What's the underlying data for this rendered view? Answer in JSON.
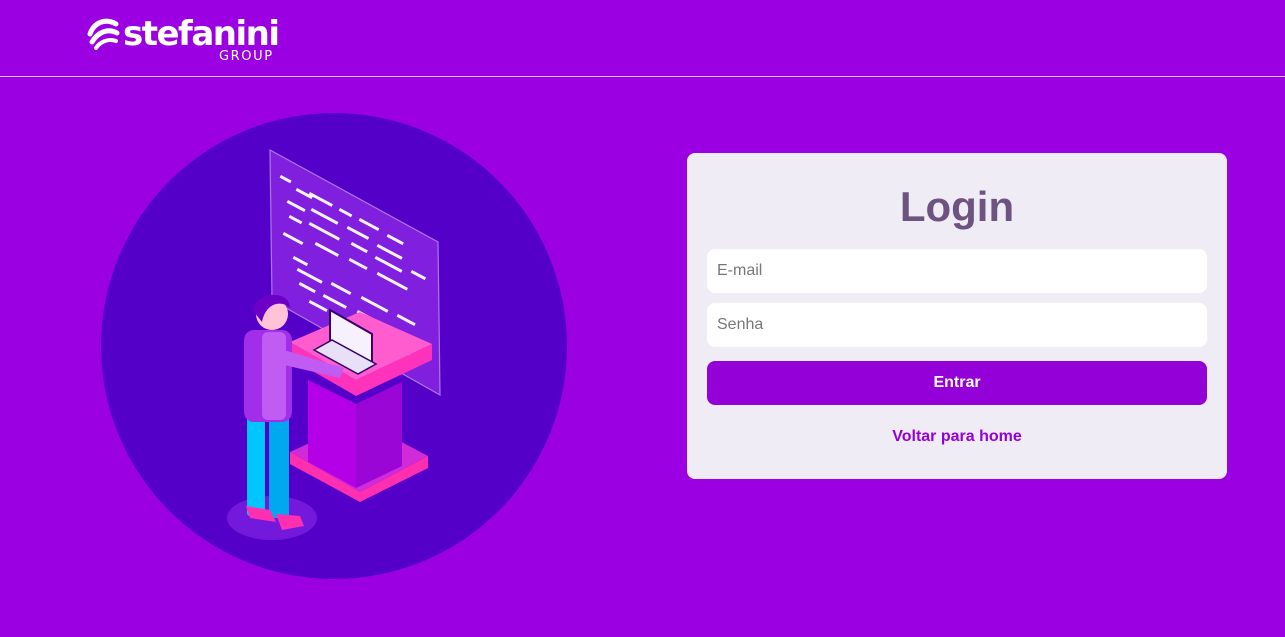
{
  "header": {
    "logo_name": "stefanini",
    "logo_sub": "GROUP",
    "logo_icon": "stefanini-swoosh-icon"
  },
  "illustration": {
    "icon": "developer-at-laptop-illustration"
  },
  "login": {
    "title": "Login",
    "email_placeholder": "E-mail",
    "email_value": "",
    "password_placeholder": "Senha",
    "password_value": "",
    "submit_label": "Entrar",
    "back_link_label": "Voltar para home"
  },
  "colors": {
    "background": "#9b00e3",
    "circle": "#5500c8",
    "card": "#f0ecf6",
    "title": "#6c5380",
    "accent": "#9400d8"
  }
}
